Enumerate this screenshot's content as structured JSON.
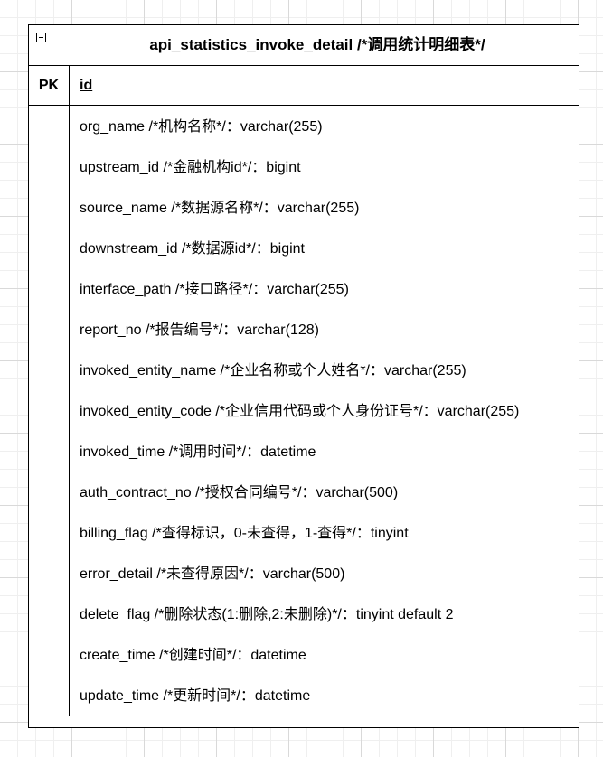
{
  "table": {
    "title": "api_statistics_invoke_detail /*调用统计明细表*/",
    "pk_label": "PK",
    "pk_field": "id",
    "fields": [
      "org_name /*机构名称*/：varchar(255)",
      "upstream_id /*金融机构id*/：bigint",
      "source_name /*数据源名称*/：varchar(255)",
      "downstream_id /*数据源id*/：bigint",
      "interface_path /*接口路径*/：varchar(255)",
      "report_no /*报告编号*/：varchar(128)",
      "invoked_entity_name /*企业名称或个人姓名*/：varchar(255)",
      "invoked_entity_code /*企业信用代码或个人身份证号*/：varchar(255)",
      "invoked_time /*调用时间*/：datetime",
      "auth_contract_no /*授权合同编号*/：varchar(500)",
      "billing_flag /*查得标识，0-未查得，1-查得*/：tinyint",
      "error_detail /*未查得原因*/：varchar(500)",
      "delete_flag /*删除状态(1:删除,2:未删除)*/：tinyint default 2",
      "create_time /*创建时间*/：datetime",
      "update_time /*更新时间*/：datetime"
    ]
  }
}
